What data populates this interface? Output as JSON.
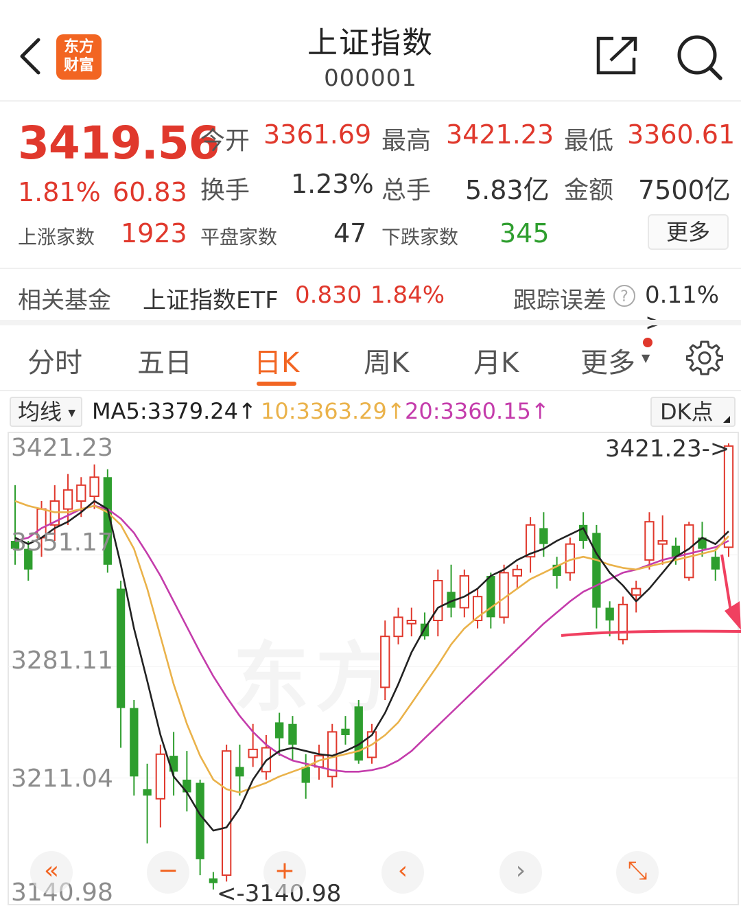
{
  "header": {
    "title": "上证指数",
    "code": "000001",
    "logo_line1": "东方",
    "logo_line2": "财富"
  },
  "quote": {
    "price": "3419.56",
    "change_pct": "1.81%",
    "change": "60.83",
    "open_label": "今开",
    "open": "3361.69",
    "high_label": "最高",
    "high": "3421.23",
    "low_label": "最低",
    "low": "3360.61",
    "turnover_label": "换手",
    "turnover": "1.23%",
    "volume_label": "总手",
    "volume": "5.83亿",
    "amount_label": "金额",
    "amount": "7500亿",
    "up_label": "上涨家数",
    "up": "1923",
    "flat_label": "平盘家数",
    "flat": "47",
    "down_label": "下跌家数",
    "down": "345",
    "more_label": "更多"
  },
  "fund": {
    "label": "相关基金",
    "name": "上证指数ETF",
    "price": "0.830",
    "pct": "1.84%",
    "track_label": "跟踪误差",
    "track_value": "0.11% >"
  },
  "tabs": [
    "分时",
    "五日",
    "日K",
    "周K",
    "月K",
    "更多"
  ],
  "active_tab": "日K",
  "ma": {
    "select_label": "均线",
    "ma5": "MA5:3379.24↑",
    "ma10": "10:3363.29↑",
    "ma20": "20:3360.15↑",
    "dk_label": "DK点"
  },
  "colors": {
    "up": "#e0382c",
    "down": "#2e9e2e",
    "accent": "#f26522",
    "ma5": "#222222",
    "ma10": "#eab24a",
    "ma20": "#c43cab"
  },
  "chart_data": {
    "type": "candlestick",
    "y_ticks": [
      "3421.23",
      "3351.17",
      "3281.11",
      "3211.04",
      "3140.98"
    ],
    "ylim": [
      3140.98,
      3421.23
    ],
    "high_annotation": "3421.23->",
    "low_annotation": "<-3140.98",
    "candles": [
      {
        "o": 3360,
        "c": 3355,
        "h": 3395,
        "l": 3345
      },
      {
        "o": 3355,
        "c": 3342,
        "h": 3360,
        "l": 3335
      },
      {
        "o": 3362,
        "c": 3380,
        "h": 3385,
        "l": 3350
      },
      {
        "o": 3370,
        "c": 3385,
        "h": 3395,
        "l": 3360
      },
      {
        "o": 3380,
        "c": 3392,
        "h": 3402,
        "l": 3370
      },
      {
        "o": 3385,
        "c": 3395,
        "h": 3400,
        "l": 3375
      },
      {
        "o": 3388,
        "c": 3400,
        "h": 3408,
        "l": 3380
      },
      {
        "o": 3400,
        "c": 3345,
        "h": 3405,
        "l": 3340
      },
      {
        "o": 3330,
        "c": 3255,
        "h": 3335,
        "l": 3230
      },
      {
        "o": 3255,
        "c": 3212,
        "h": 3260,
        "l": 3200
      },
      {
        "o": 3204,
        "c": 3200,
        "h": 3220,
        "l": 3170
      },
      {
        "o": 3198,
        "c": 3226,
        "h": 3232,
        "l": 3180
      },
      {
        "o": 3225,
        "c": 3215,
        "h": 3240,
        "l": 3200
      },
      {
        "o": 3210,
        "c": 3202,
        "h": 3228,
        "l": 3190
      },
      {
        "o": 3208,
        "c": 3160,
        "h": 3210,
        "l": 3150
      },
      {
        "o": 3148,
        "c": 3145,
        "h": 3152,
        "l": 3141
      },
      {
        "o": 3150,
        "c": 3228,
        "h": 3232,
        "l": 3146
      },
      {
        "o": 3218,
        "c": 3212,
        "h": 3232,
        "l": 3200
      },
      {
        "o": 3224,
        "c": 3229,
        "h": 3245,
        "l": 3218
      },
      {
        "o": 3215,
        "c": 3230,
        "h": 3238,
        "l": 3210
      },
      {
        "o": 3246,
        "c": 3236,
        "h": 3252,
        "l": 3225
      },
      {
        "o": 3245,
        "c": 3232,
        "h": 3250,
        "l": 3222
      },
      {
        "o": 3218,
        "c": 3208,
        "h": 3226,
        "l": 3198
      },
      {
        "o": 3218,
        "c": 3225,
        "h": 3232,
        "l": 3210
      },
      {
        "o": 3212,
        "c": 3240,
        "h": 3245,
        "l": 3205
      },
      {
        "o": 3242,
        "c": 3238,
        "h": 3250,
        "l": 3232
      },
      {
        "o": 3256,
        "c": 3222,
        "h": 3260,
        "l": 3220
      },
      {
        "o": 3224,
        "c": 3240,
        "h": 3245,
        "l": 3220
      },
      {
        "o": 3268,
        "c": 3300,
        "h": 3310,
        "l": 3260
      },
      {
        "o": 3300,
        "c": 3312,
        "h": 3318,
        "l": 3295
      },
      {
        "o": 3308,
        "c": 3310,
        "h": 3318,
        "l": 3300
      },
      {
        "o": 3308,
        "c": 3300,
        "h": 3315,
        "l": 3298
      },
      {
        "o": 3310,
        "c": 3335,
        "h": 3342,
        "l": 3300
      },
      {
        "o": 3328,
        "c": 3318,
        "h": 3345,
        "l": 3312
      },
      {
        "o": 3318,
        "c": 3338,
        "h": 3342,
        "l": 3312
      },
      {
        "o": 3310,
        "c": 3325,
        "h": 3330,
        "l": 3305
      },
      {
        "o": 3338,
        "c": 3312,
        "h": 3340,
        "l": 3305
      },
      {
        "o": 3312,
        "c": 3340,
        "h": 3345,
        "l": 3308
      },
      {
        "o": 3338,
        "c": 3342,
        "h": 3345,
        "l": 3330
      },
      {
        "o": 3350,
        "c": 3370,
        "h": 3375,
        "l": 3340
      },
      {
        "o": 3368,
        "c": 3358,
        "h": 3378,
        "l": 3350
      },
      {
        "o": 3345,
        "c": 3338,
        "h": 3350,
        "l": 3330
      },
      {
        "o": 3340,
        "c": 3358,
        "h": 3362,
        "l": 3335
      },
      {
        "o": 3370,
        "c": 3360,
        "h": 3378,
        "l": 3355
      },
      {
        "o": 3365,
        "c": 3318,
        "h": 3370,
        "l": 3305
      },
      {
        "o": 3318,
        "c": 3310,
        "h": 3322,
        "l": 3300
      },
      {
        "o": 3298,
        "c": 3320,
        "h": 3325,
        "l": 3295
      },
      {
        "o": 3326,
        "c": 3330,
        "h": 3335,
        "l": 3315
      },
      {
        "o": 3348,
        "c": 3372,
        "h": 3378,
        "l": 3342
      },
      {
        "o": 3358,
        "c": 3360,
        "h": 3376,
        "l": 3345
      },
      {
        "o": 3357,
        "c": 3350,
        "h": 3362,
        "l": 3345
      },
      {
        "o": 3337,
        "c": 3370,
        "h": 3372,
        "l": 3335
      },
      {
        "o": 3362,
        "c": 3355,
        "h": 3372,
        "l": 3350
      },
      {
        "o": 3350,
        "c": 3342,
        "h": 3355,
        "l": 3335
      },
      {
        "o": 3356,
        "c": 3419.56,
        "h": 3421.23,
        "l": 3350
      }
    ],
    "ma5": [
      3362,
      3358,
      3362,
      3368,
      3372,
      3378,
      3385,
      3380,
      3345,
      3305,
      3272,
      3238,
      3212,
      3202,
      3188,
      3178,
      3180,
      3192,
      3210,
      3222,
      3228,
      3230,
      3228,
      3226,
      3225,
      3228,
      3232,
      3238,
      3252,
      3270,
      3290,
      3305,
      3318,
      3322,
      3325,
      3330,
      3338,
      3342,
      3348,
      3352,
      3355,
      3360,
      3364,
      3368,
      3352,
      3340,
      3332,
      3322,
      3330,
      3340,
      3350,
      3355,
      3362,
      3358,
      3366
    ],
    "ma10": [
      3385,
      3382,
      3380,
      3378,
      3378,
      3380,
      3382,
      3378,
      3370,
      3355,
      3330,
      3300,
      3270,
      3245,
      3225,
      3210,
      3204,
      3202,
      3205,
      3208,
      3212,
      3215,
      3218,
      3222,
      3224,
      3226,
      3228,
      3232,
      3238,
      3246,
      3258,
      3270,
      3282,
      3295,
      3305,
      3312,
      3318,
      3324,
      3330,
      3336,
      3340,
      3344,
      3348,
      3350,
      3348,
      3345,
      3343,
      3342,
      3344,
      3346,
      3348,
      3350,
      3352,
      3354,
      3363
    ],
    "ma20": [
      3360,
      3362,
      3368,
      3372,
      3376,
      3380,
      3382,
      3380,
      3374,
      3365,
      3352,
      3338,
      3322,
      3306,
      3290,
      3275,
      3262,
      3250,
      3240,
      3232,
      3226,
      3222,
      3220,
      3218,
      3216,
      3215,
      3215,
      3216,
      3218,
      3222,
      3228,
      3236,
      3244,
      3252,
      3260,
      3268,
      3276,
      3284,
      3292,
      3300,
      3308,
      3315,
      3322,
      3328,
      3332,
      3336,
      3340,
      3342,
      3345,
      3348,
      3350,
      3352,
      3354,
      3356,
      3360
    ]
  },
  "controls": [
    "«",
    "−",
    "+",
    "‹",
    "›",
    "⤡"
  ]
}
